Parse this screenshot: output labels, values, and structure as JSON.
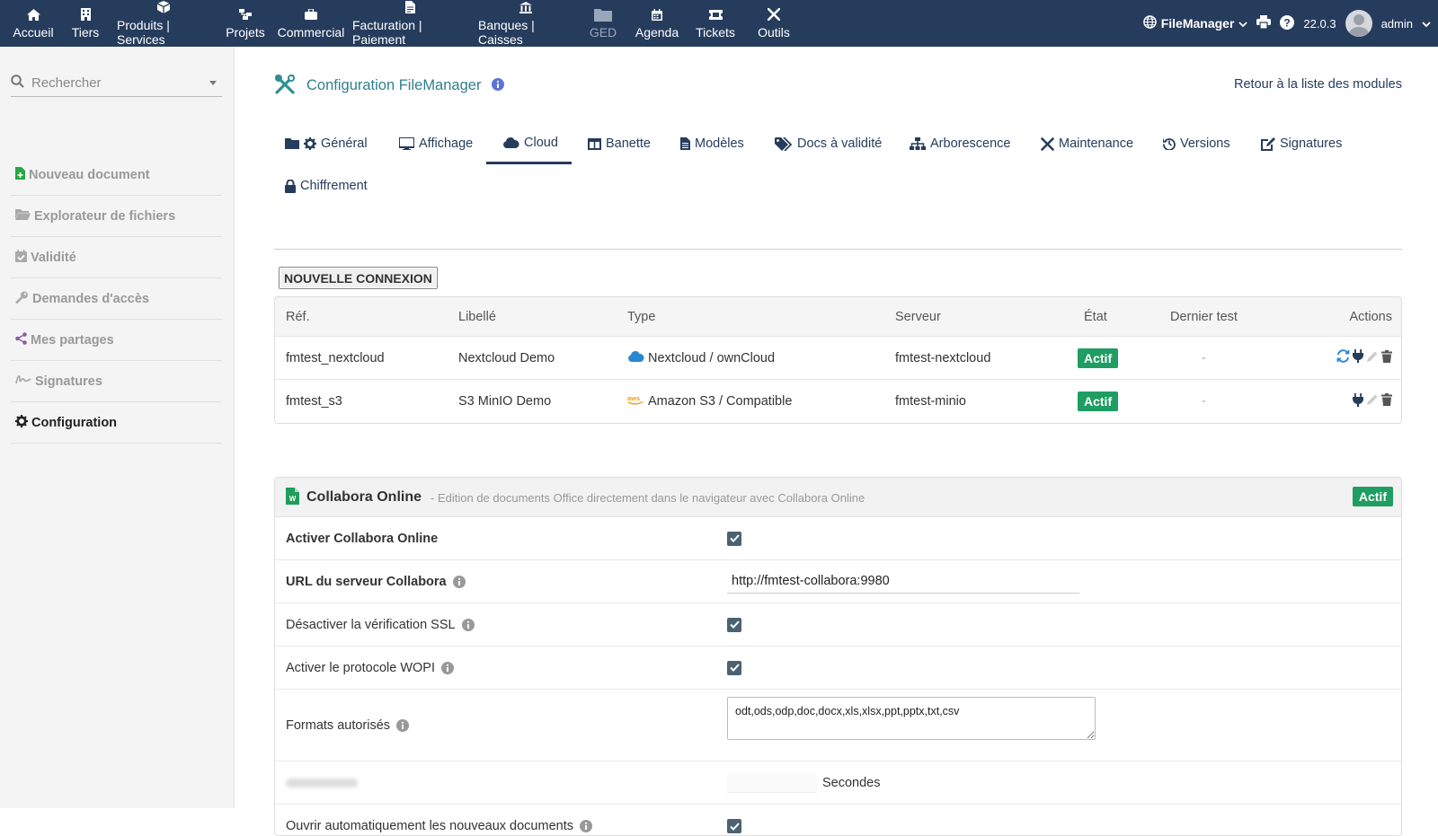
{
  "topmenu": [
    {
      "label": "Accueil",
      "icon": "home-icon"
    },
    {
      "label": "Tiers",
      "icon": "building-icon"
    },
    {
      "label": "Produits | Services",
      "icon": "cube-icon"
    },
    {
      "label": "Projets",
      "icon": "sitemap-icon"
    },
    {
      "label": "Commercial",
      "icon": "briefcase-icon"
    },
    {
      "label": "Facturation | Paiement",
      "icon": "file-invoice-icon"
    },
    {
      "label": "Banques | Caisses",
      "icon": "bank-icon"
    },
    {
      "label": "GED",
      "icon": "folder-icon"
    },
    {
      "label": "Agenda",
      "icon": "calendar-icon"
    },
    {
      "label": "Tickets",
      "icon": "ticket-icon"
    },
    {
      "label": "Outils",
      "icon": "tools-icon"
    }
  ],
  "topright": {
    "entity": "FileManager",
    "version": "22.0.3",
    "user": "admin"
  },
  "sidebar": {
    "search_placeholder": "Rechercher",
    "items": [
      {
        "label": "Nouveau document",
        "icon": "file-plus-icon"
      },
      {
        "label": "Explorateur de fichiers",
        "icon": "folder-open-icon"
      },
      {
        "label": "Validité",
        "icon": "calendar-check-icon"
      },
      {
        "label": "Demandes d'accès",
        "icon": "key-icon"
      },
      {
        "label": "Mes partages",
        "icon": "share-icon"
      },
      {
        "label": "Signatures",
        "icon": "signature-icon"
      },
      {
        "label": "Configuration",
        "icon": "gear-icon"
      }
    ]
  },
  "page": {
    "title": "Configuration FileManager",
    "back_link": "Retour à la liste des modules"
  },
  "tabs": [
    {
      "label": "Général",
      "icon": "gear-icon"
    },
    {
      "label": "Affichage",
      "icon": "desktop-icon"
    },
    {
      "label": "Cloud",
      "icon": "cloud-icon"
    },
    {
      "label": "Banette",
      "icon": "columns-icon"
    },
    {
      "label": "Modèles",
      "icon": "file-text-icon"
    },
    {
      "label": "Docs à validité",
      "icon": "tags-icon"
    },
    {
      "label": "Arborescence",
      "icon": "sitemap-icon"
    },
    {
      "label": "Maintenance",
      "icon": "tools-icon"
    },
    {
      "label": "Versions",
      "icon": "history-icon"
    },
    {
      "label": "Signatures",
      "icon": "pen-square-icon"
    },
    {
      "label": "Chiffrement",
      "icon": "lock-icon"
    }
  ],
  "new_connection_label": "NOUVELLE CONNEXION",
  "connections": {
    "headers": {
      "ref": "Réf.",
      "label": "Libellé",
      "type": "Type",
      "server": "Serveur",
      "state": "État",
      "last_test": "Dernier test",
      "actions": "Actions"
    },
    "rows": [
      {
        "ref": "fmtest_nextcloud",
        "label": "Nextcloud Demo",
        "type": "Nextcloud / ownCloud",
        "server": "fmtest-nextcloud",
        "state": "Actif",
        "last_test": "-"
      },
      {
        "ref": "fmtest_s3",
        "label": "S3 MinIO Demo",
        "type": "Amazon S3 / Compatible",
        "server": "fmtest-minio",
        "state": "Actif",
        "last_test": "-"
      }
    ]
  },
  "collabora": {
    "title": "Collabora Online",
    "description": "- Edition de documents Office directement dans le navigateur avec Collabora Online",
    "badge": "Actif",
    "fields": {
      "enable": {
        "label": "Activer Collabora Online",
        "checked": true
      },
      "url": {
        "label": "URL du serveur Collabora",
        "value": "http://fmtest-collabora:9980"
      },
      "ssl": {
        "label": "Désactiver la vérification SSL",
        "checked": true
      },
      "wopi": {
        "label": "Activer le protocole WOPI",
        "checked": true
      },
      "formats": {
        "label": "Formats autorisés",
        "value": "odt,ods,odp,doc,docx,xls,xlsx,ppt,pptx,txt,csv"
      },
      "timeout": {
        "unit": "Secondes"
      },
      "autoopen": {
        "label": "Ouvrir automatiquement les nouveaux documents",
        "checked": true
      }
    }
  },
  "colors": {
    "topbar": "#263c5c",
    "accent": "#2f7f8f",
    "badge": "#1f9d62"
  }
}
